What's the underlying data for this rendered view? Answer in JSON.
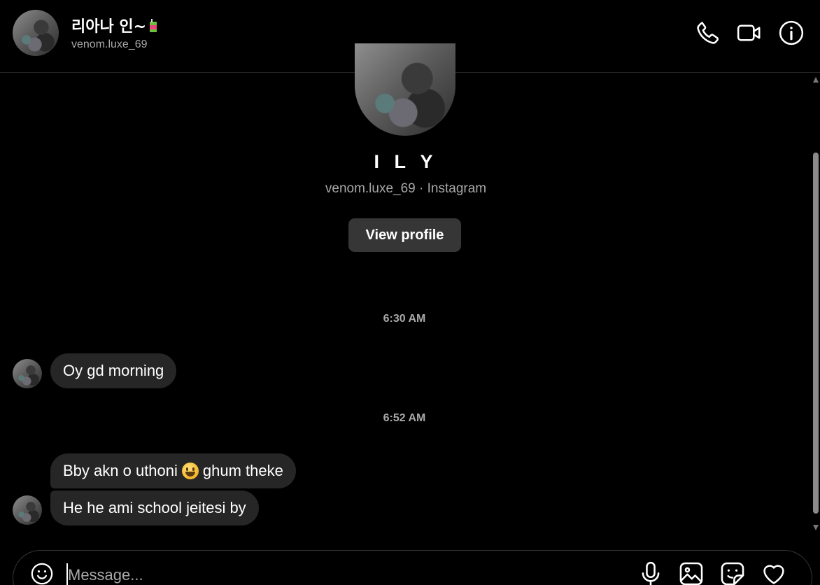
{
  "header": {
    "name": "리아나 인~",
    "username": "venom.luxe_69"
  },
  "profile": {
    "display_name": "I L Y",
    "subtitle": "venom.luxe_69 · Instagram",
    "view_profile_label": "View profile"
  },
  "timestamps": [
    "6:30 AM",
    "6:52 AM"
  ],
  "messages": [
    {
      "text": "Oy gd morning"
    },
    {
      "text_before": "Bby akn o uthoni",
      "text_after": "ghum theke"
    },
    {
      "text": "He he ami school jeitesi by"
    }
  ],
  "composer": {
    "placeholder": "Message..."
  },
  "icons": {
    "call": "phone-icon",
    "video": "video-camera-icon",
    "info": "info-icon",
    "emoji": "smiley-icon",
    "mic": "microphone-icon",
    "image": "image-icon",
    "sticker": "sticker-icon",
    "like": "heart-icon"
  }
}
